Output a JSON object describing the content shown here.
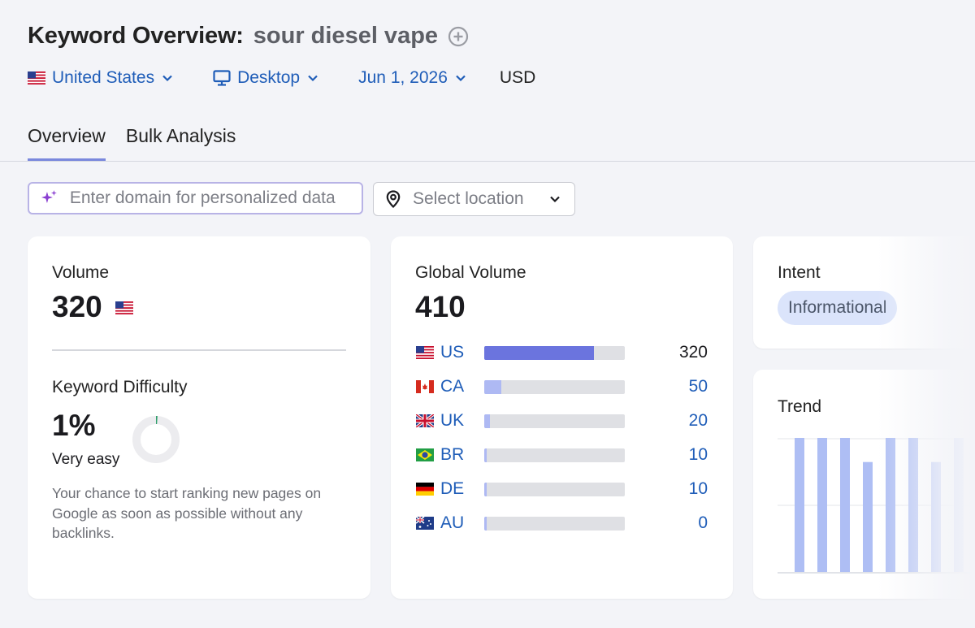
{
  "header": {
    "title_prefix": "Keyword Overview:",
    "keyword": "sour diesel vape",
    "add_icon": "plus-circle-icon"
  },
  "filters": {
    "country": "United States",
    "device": "Desktop",
    "date": "Jun 1, 2026",
    "currency": "USD"
  },
  "tabs": [
    {
      "label": "Overview",
      "active": true
    },
    {
      "label": "Bulk Analysis",
      "active": false
    }
  ],
  "domain_input": {
    "placeholder": "Enter domain for personalized data",
    "icon": "sparkle-icon"
  },
  "location_select": {
    "placeholder": "Select location",
    "icon": "location-pin-icon"
  },
  "volume_card": {
    "label": "Volume",
    "value": "320",
    "kd_label": "Keyword Difficulty",
    "kd_value": "1%",
    "kd_level": 0.01,
    "kd_text": "Very easy",
    "kd_description": "Your chance to start ranking new pages on Google as soon as possible without any backlinks."
  },
  "global_volume_card": {
    "label": "Global Volume",
    "value": "410",
    "rows": [
      {
        "code": "US",
        "value": "320",
        "share": 0.78,
        "color": "#6b74de",
        "value_color": "#1b1b1f"
      },
      {
        "code": "CA",
        "value": "50",
        "share": 0.12,
        "color": "#aeb9f3",
        "value_color": "#1f5db8"
      },
      {
        "code": "UK",
        "value": "20",
        "share": 0.04,
        "color": "#aeb9f3",
        "value_color": "#1f5db8"
      },
      {
        "code": "BR",
        "value": "10",
        "share": 0.02,
        "color": "#aeb9f3",
        "value_color": "#1f5db8"
      },
      {
        "code": "DE",
        "value": "10",
        "share": 0.02,
        "color": "#aeb9f3",
        "value_color": "#1f5db8"
      },
      {
        "code": "AU",
        "value": "0",
        "share": 0.02,
        "color": "#aeb9f3",
        "value_color": "#1f5db8"
      }
    ]
  },
  "intent_card": {
    "label": "Intent",
    "badge": "Informational",
    "badge_bg": "#dbe4fb",
    "badge_color": "#4a5568"
  },
  "trend_card": {
    "label": "Trend",
    "chart_data": {
      "type": "bar",
      "values": [
        1.0,
        1.0,
        1.0,
        0.82,
        1.0,
        1.0,
        0.82,
        1.0
      ],
      "ylim": [
        0,
        1
      ]
    },
    "bar_color": "#aebef4"
  },
  "colors": {
    "link": "#1f5db8",
    "tab_underline": "#7a88dd",
    "background": "#f3f4f8"
  }
}
